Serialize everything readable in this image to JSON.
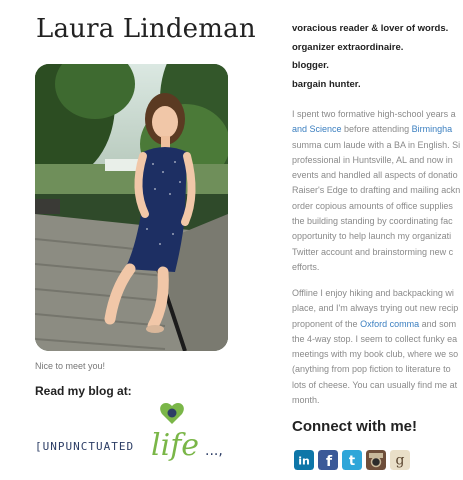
{
  "profile": {
    "name": "Laura Lindeman",
    "caption": "Nice to meet you!",
    "blog_heading": "Read my blog at:",
    "blog_logo_text": "[UNPUNCTUATED life...,"
  },
  "taglines": [
    "voracious reader & lover of words.",
    "organizer extraordinaire.",
    "blogger.",
    "bargain hunter."
  ],
  "about": {
    "p1": {
      "l1": "I spent two formative high-school years a",
      "l2a": "and Science",
      "l2b": " before attending ",
      "l2c": "Birmingha",
      "l3": "summa cum laude with a BA in English. Si",
      "l4": "professional in Huntsville, AL and now in",
      "l5": "events and handled all aspects of donatio",
      "l6": "Raiser's Edge to drafting and mailing ackn",
      "l7": "order copious amounts of office supplies",
      "l8": "the building standing by coordinating fac",
      "l9": "opportunity to help launch my organizati",
      "l10": "Twitter account and brainstorming new c",
      "l11": "efforts."
    },
    "p2": {
      "l1": "Offline I enjoy hiking and backpacking wi",
      "l2": "place, and I'm always trying out new recip",
      "l3a": "proponent of the ",
      "l3b": "Oxford comma",
      "l3c": " and som",
      "l4": "the 4-way stop. I seem to collect funky ea",
      "l5": "meetings with my book club, where we so",
      "l6": "(anything from pop fiction to literature to",
      "l7": "lots of cheese. You can usually find me at",
      "l8": "month."
    }
  },
  "connect": {
    "heading": "Connect with me!",
    "icons": [
      {
        "name": "linkedin-icon",
        "glyph": "in",
        "color": "#0e76a8"
      },
      {
        "name": "facebook-icon",
        "glyph": "f",
        "color": "#3b5998"
      },
      {
        "name": "twitter-icon",
        "glyph": "t",
        "color": "#2fa6d9"
      },
      {
        "name": "instagram-icon",
        "glyph": "◉",
        "color": "#6e4e3a"
      },
      {
        "name": "goodreads-icon",
        "glyph": "g",
        "color": "#c9b48a"
      }
    ]
  },
  "colors": {
    "link": "#3b7fc0",
    "logo_green": "#7ab648",
    "logo_navy": "#2d3e66"
  }
}
